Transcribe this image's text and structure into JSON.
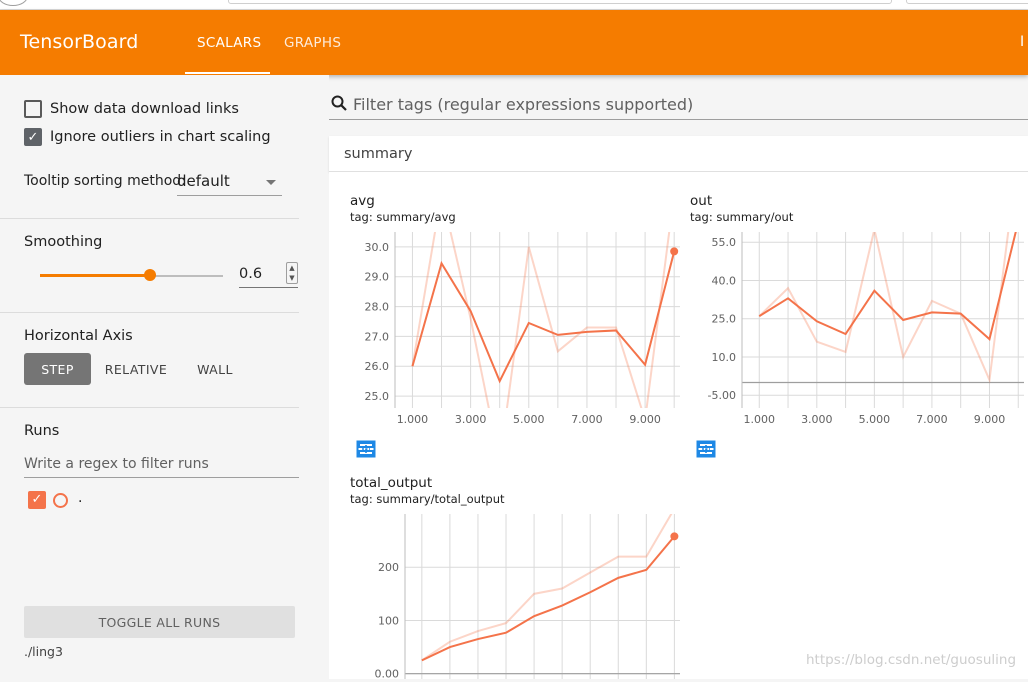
{
  "app": {
    "title": "TensorBoard",
    "tabs": [
      {
        "label": "SCALARS",
        "active": true
      },
      {
        "label": "GRAPHS",
        "active": false
      }
    ],
    "edge_char": "I"
  },
  "sidebar": {
    "show_download_links": {
      "label": "Show data download links",
      "checked": false
    },
    "ignore_outliers": {
      "label": "Ignore outliers in chart scaling",
      "checked": true
    },
    "tooltip_sorting": {
      "label": "Tooltip sorting method:",
      "value": "default"
    },
    "smoothing": {
      "label": "Smoothing",
      "value": "0.6",
      "fraction": 0.6
    },
    "horizontal_axis": {
      "label": "Horizontal Axis",
      "options": [
        {
          "label": "STEP",
          "active": true
        },
        {
          "label": "RELATIVE",
          "active": false
        },
        {
          "label": "WALL",
          "active": false
        }
      ]
    },
    "runs": {
      "label": "Runs",
      "filter_placeholder": "Write a regex to filter runs",
      "items": [
        {
          "label": ".",
          "checked": true,
          "color": "#f4734a"
        }
      ]
    },
    "toggle_all_runs": "TOGGLE ALL RUNS",
    "logdir": "./ling3"
  },
  "main": {
    "search_placeholder": "Filter tags (regular expressions supported)",
    "section_title": "summary"
  },
  "colors": {
    "accent": "#f57c00",
    "run": "#f4734a",
    "icon_blue": "#1e88e5"
  },
  "chart_data": [
    {
      "type": "line",
      "title": "avg",
      "subtitle": "tag: summary/avg",
      "x": [
        1,
        2,
        3,
        4,
        5,
        6,
        7,
        8,
        9,
        10
      ],
      "xticks": [
        "1.000",
        "3.000",
        "5.000",
        "7.000",
        "9.000"
      ],
      "yticks": [
        "25.0",
        "26.0",
        "27.0",
        "28.0",
        "29.0",
        "30.0"
      ],
      "ylim": [
        24.6,
        30.5
      ],
      "xlim": [
        0.4,
        10.2
      ],
      "series": [
        {
          "role": "smoothed",
          "values": [
            26.0,
            29.45,
            27.85,
            25.5,
            27.45,
            27.05,
            27.15,
            27.2,
            26.05,
            29.85
          ]
        },
        {
          "role": "raw",
          "values": [
            26.0,
            31.8,
            27.6,
            22.8,
            30.0,
            26.5,
            27.3,
            27.3,
            24.2,
            31.8
          ]
        }
      ],
      "grid": true
    },
    {
      "type": "line",
      "title": "out",
      "subtitle": "tag: summary/out",
      "x": [
        1,
        2,
        3,
        4,
        5,
        6,
        7,
        8,
        9,
        10
      ],
      "xticks": [
        "1.000",
        "3.000",
        "5.000",
        "7.000",
        "9.000"
      ],
      "yticks": [
        "-5.00",
        "10.0",
        "25.0",
        "40.0",
        "55.0"
      ],
      "ylim": [
        -10,
        59
      ],
      "xlim": [
        0.4,
        10.2
      ],
      "series": [
        {
          "role": "smoothed",
          "values": [
            26,
            33,
            24,
            19,
            36,
            24.5,
            27.5,
            27,
            17,
            63
          ]
        },
        {
          "role": "raw",
          "values": [
            26,
            37,
            16,
            12,
            60,
            10,
            32,
            27,
            1,
            90
          ]
        }
      ],
      "grid": true
    },
    {
      "type": "line",
      "title": "total_output",
      "subtitle": "tag: summary/total_output",
      "x": [
        1,
        2,
        3,
        4,
        5,
        6,
        7,
        8,
        9,
        10
      ],
      "yticks": [
        "0.00",
        "100",
        "200"
      ],
      "ylim": [
        -10,
        300
      ],
      "xlim": [
        0.4,
        10.2
      ],
      "series": [
        {
          "role": "smoothed",
          "values": [
            25,
            50,
            65,
            77,
            108,
            128,
            153,
            180,
            195,
            258
          ]
        },
        {
          "role": "raw",
          "values": [
            25,
            60,
            80,
            95,
            150,
            160,
            190,
            220,
            220,
            310
          ]
        }
      ],
      "grid": true
    }
  ]
}
